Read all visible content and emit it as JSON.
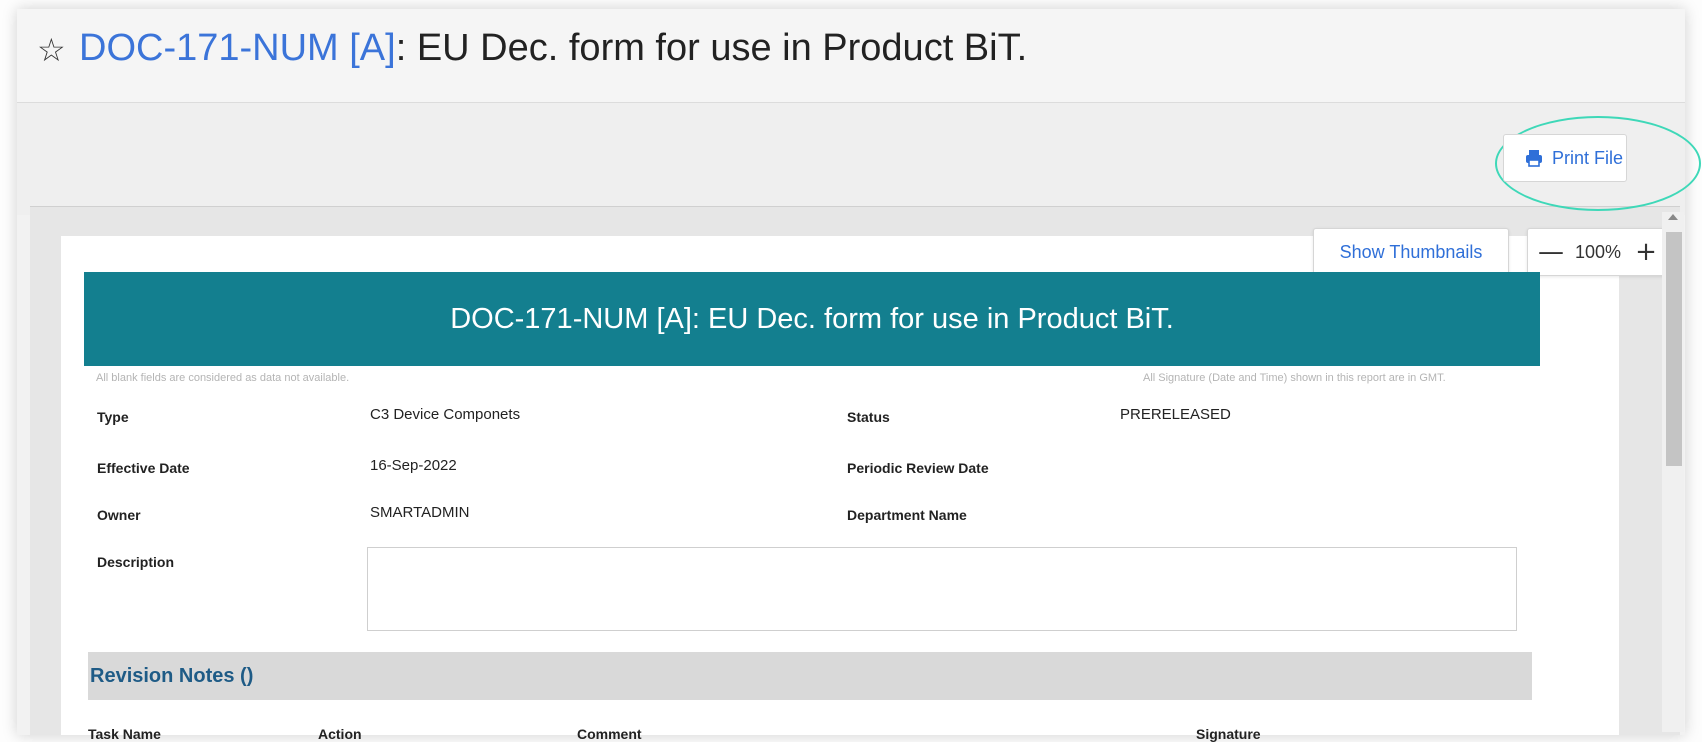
{
  "header": {
    "doc_link": "DOC-171-NUM [A]",
    "title_rest": ": EU Dec. form for use in Product BiT."
  },
  "toolbar": {
    "print_label": "Print File",
    "thumbnails_label": "Show Thumbnails",
    "zoom_level": "100%",
    "zoom_out_glyph": "—",
    "zoom_in_glyph": "+"
  },
  "document": {
    "banner_title": "DOC-171-NUM [A]: EU Dec. form for use in Product BiT.",
    "note_left": "All blank fields are considered as data not available.",
    "note_right": "All Signature (Date and Time) shown in this report are in GMT.",
    "fields": {
      "type_label": "Type",
      "type_value": "C3 Device Componets",
      "status_label": "Status",
      "status_value": "PRERELEASED",
      "effective_date_label": "Effective Date",
      "effective_date_value": "16-Sep-2022",
      "periodic_review_label": "Periodic Review Date",
      "owner_label": "Owner",
      "owner_value": "SMARTADMIN",
      "department_label": "Department Name",
      "description_label": "Description"
    },
    "revision_notes": {
      "title": "Revision Notes ()",
      "columns": [
        "Task Name",
        "Action",
        "Comment",
        "Signature"
      ]
    }
  },
  "icons": {
    "star": "star-outline-icon",
    "print": "printer-icon"
  },
  "colors": {
    "link": "#3b74d9",
    "banner": "#137f8f",
    "highlight": "#3ed8b8",
    "revision_title": "#1e5b86"
  }
}
